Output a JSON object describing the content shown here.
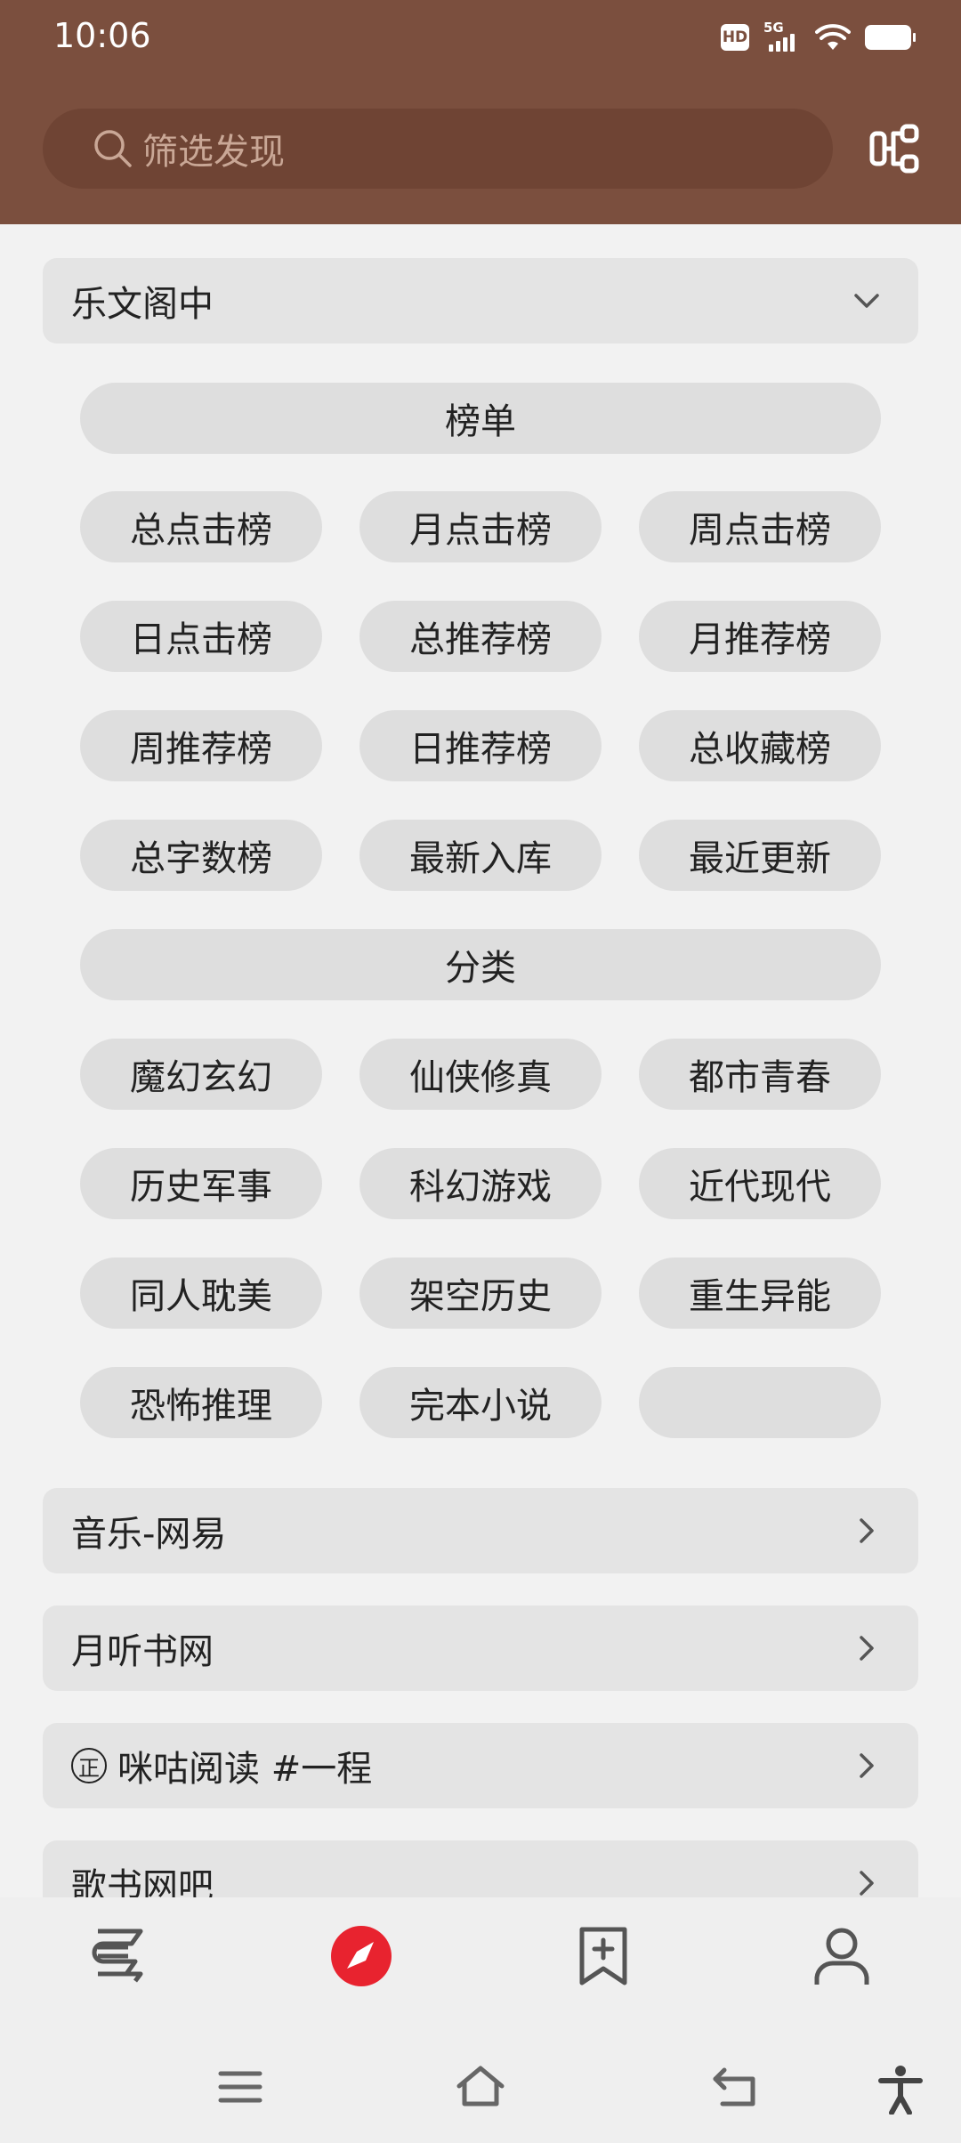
{
  "status_bar": {
    "time": "10:06",
    "hd_label": "HD",
    "network_label": "5G"
  },
  "search": {
    "placeholder": "筛选发现"
  },
  "sections": {
    "lewenge": {
      "title": "乐文阁中",
      "expanded": true,
      "groups": [
        {
          "header": "榜单",
          "items": [
            "总点击榜",
            "月点击榜",
            "周点击榜",
            "日点击榜",
            "总推荐榜",
            "月推荐榜",
            "周推荐榜",
            "日推荐榜",
            "总收藏榜",
            "总字数榜",
            "最新入库",
            "最近更新"
          ]
        },
        {
          "header": "分类",
          "items": [
            "魔幻玄幻",
            "仙侠修真",
            "都市青春",
            "历史军事",
            "科幻游戏",
            "近代现代",
            "同人耽美",
            "架空历史",
            "重生异能",
            "恐怖推理",
            "完本小说",
            ""
          ]
        }
      ]
    },
    "collapsed": [
      {
        "title": "音乐-网易",
        "prefix": ""
      },
      {
        "title": "月听书网",
        "prefix": ""
      },
      {
        "title": "咪咕阅读 #一程",
        "prefix": "正"
      },
      {
        "title": "歌书网吧",
        "prefix": ""
      }
    ]
  },
  "bottom_nav": {
    "items": [
      "bookshelf",
      "discover",
      "rss",
      "my"
    ],
    "active": "discover",
    "active_color": "#e8232f"
  },
  "colors": {
    "header_bg": "#7b4f3e",
    "search_bg": "#6f4434",
    "pill_bg": "#dedede"
  }
}
